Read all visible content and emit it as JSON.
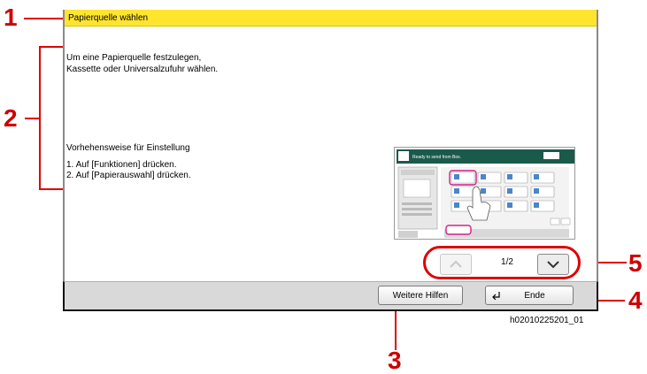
{
  "callouts": [
    "1",
    "2",
    "3",
    "4",
    "5"
  ],
  "dialog": {
    "title": "Papierquelle wählen",
    "description": "Um eine Papierquelle festzulegen,\nKassette oder Universalzufuhr wählen.",
    "steps_heading": "Vorhehensweise für Einstellung",
    "steps": [
      "1. Auf [Funktionen] drücken.",
      "2. Auf [Papierauswahl] drücken."
    ]
  },
  "thumbnail": {
    "header": "Ready to send from Box."
  },
  "pager": {
    "label": "1/2",
    "up_icon": "chevron-up-icon",
    "down_icon": "chevron-down-icon"
  },
  "footer": {
    "more_help_label": "Weitere Hilfen",
    "end_label": "Ende",
    "end_icon": "return-arrow-icon"
  },
  "image_caption": "h02010225201_01",
  "colors": {
    "titlebar": "#ffe52e",
    "callout": "#cc0000",
    "thumb_header": "#1a5a4a"
  }
}
